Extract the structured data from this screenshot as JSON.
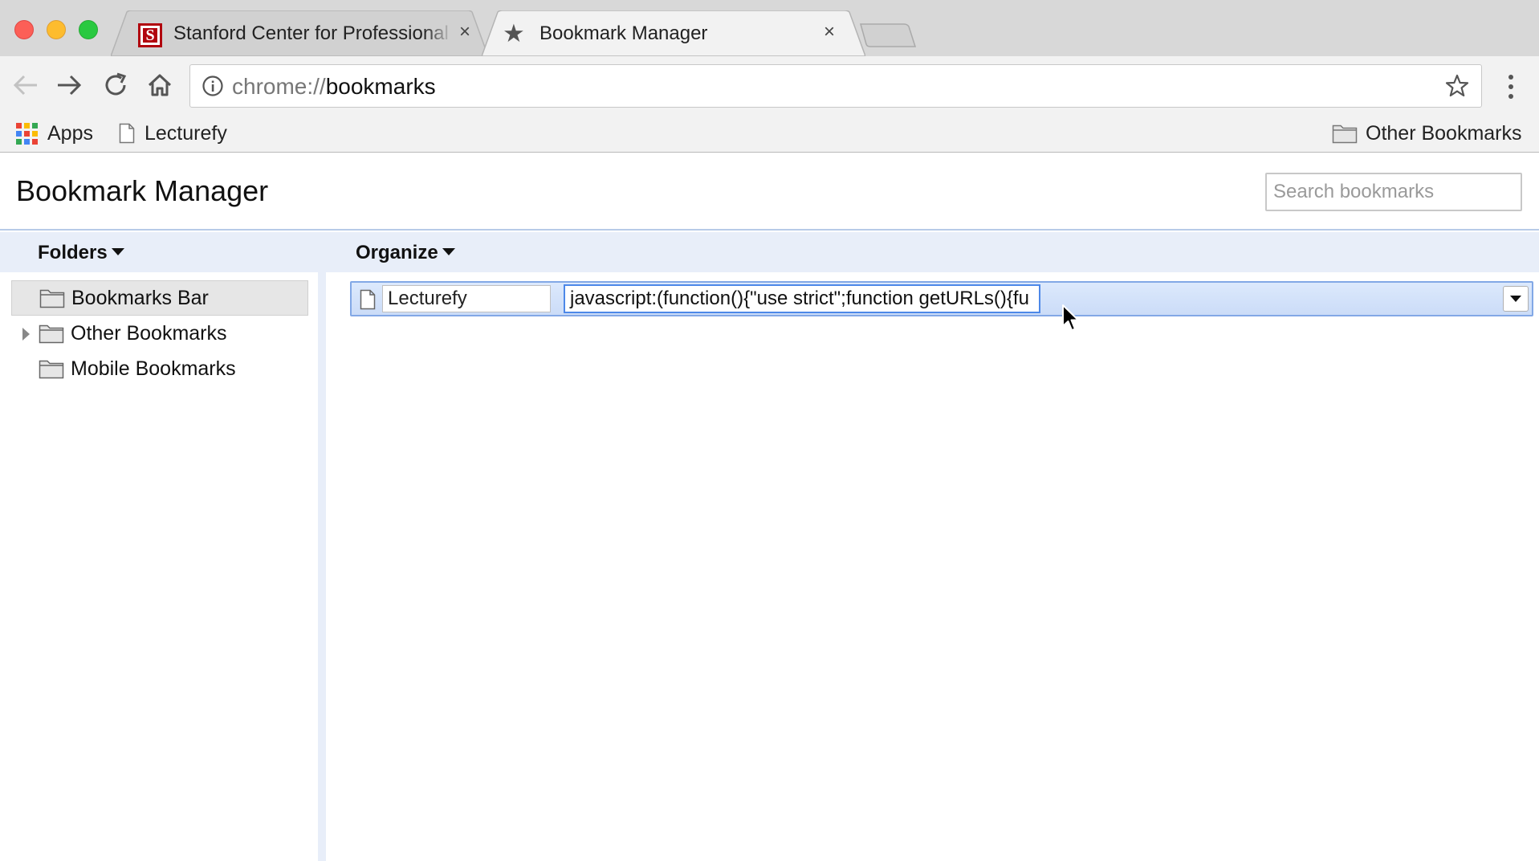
{
  "window": {
    "tabs": [
      {
        "title": "Stanford Center for Professional Development",
        "favicon": "stanford-s-icon",
        "close": "×"
      },
      {
        "title": "Bookmark Manager",
        "favicon": "star-icon",
        "close": "×"
      }
    ]
  },
  "toolbar": {
    "back_icon": "back-arrow-icon",
    "forward_icon": "forward-arrow-icon",
    "reload_icon": "reload-icon",
    "home_icon": "home-icon",
    "url_scheme": "chrome://",
    "url_host": "bookmarks",
    "bookmark_star_icon": "star-outline-icon",
    "menu_icon": "kebab-menu-icon"
  },
  "bookmarks_bar": {
    "apps_label": "Apps",
    "items": [
      {
        "label": "Lecturefy"
      }
    ],
    "other_label": "Other Bookmarks"
  },
  "manager": {
    "title": "Bookmark Manager",
    "search_placeholder": "Search bookmarks",
    "folders_label": "Folders",
    "organize_label": "Organize",
    "tree": [
      {
        "label": "Bookmarks Bar",
        "selected": true,
        "expandable": false
      },
      {
        "label": "Other Bookmarks",
        "selected": false,
        "expandable": true
      },
      {
        "label": "Mobile Bookmarks",
        "selected": false,
        "expandable": false
      }
    ],
    "list": [
      {
        "name": "Lecturefy",
        "url": "javascript:(function(){\"use strict\";function getURLs(){fu"
      }
    ]
  },
  "colors": {
    "accent": "#4d88e8",
    "selection_row": "#dce9fc",
    "toolbar_band": "#e8eef9",
    "stanford_red": "#b1040e"
  },
  "apps_grid_colors": [
    "#ea4335",
    "#fbbc05",
    "#34a853",
    "#4285f4",
    "#ea4335",
    "#fbbc05",
    "#34a853",
    "#4285f4",
    "#ea4335"
  ]
}
